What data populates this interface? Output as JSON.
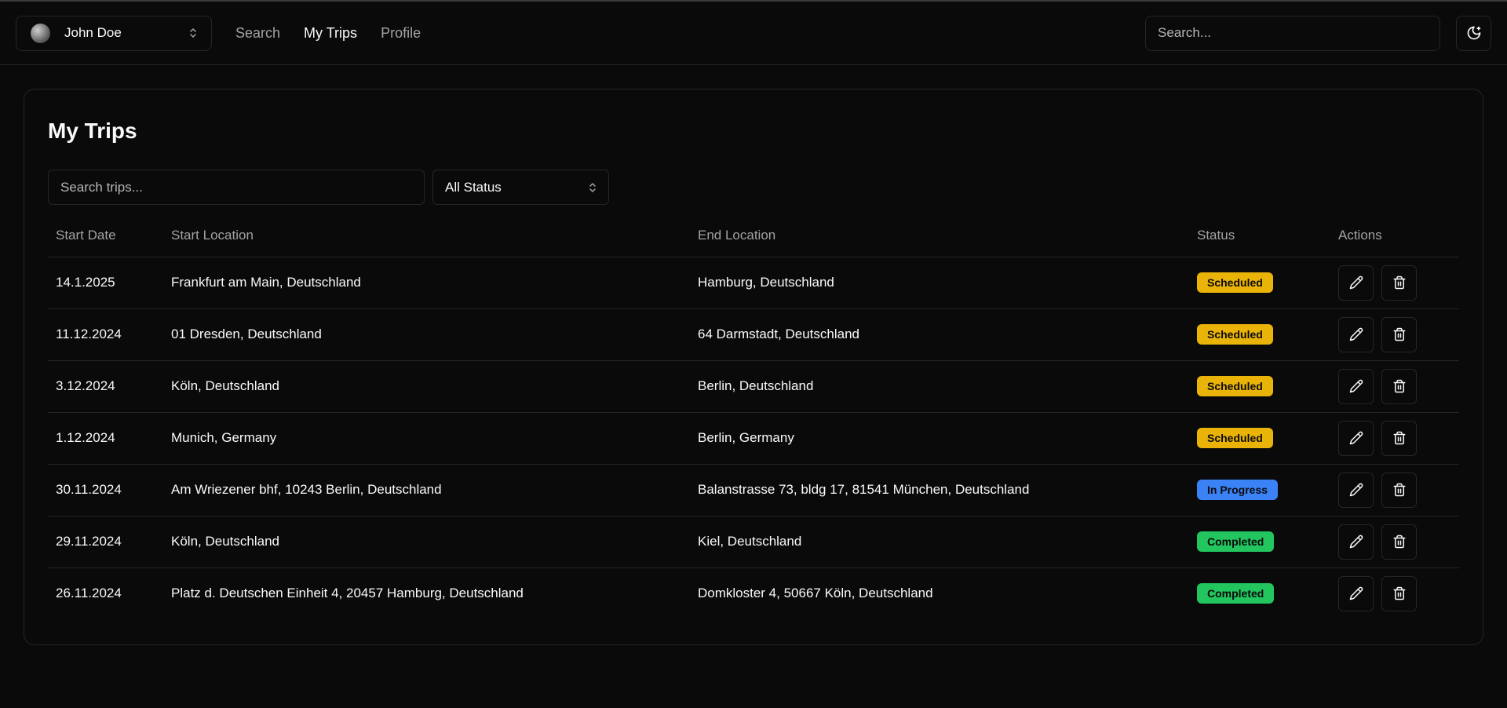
{
  "header": {
    "user_name": "John Doe",
    "nav": [
      {
        "label": "Search",
        "active": false
      },
      {
        "label": "My Trips",
        "active": true
      },
      {
        "label": "Profile",
        "active": false
      }
    ],
    "search_placeholder": "Search...",
    "theme_icon": "moon-icon"
  },
  "page": {
    "title": "My Trips",
    "search_placeholder": "Search trips...",
    "status_filter": "All Status"
  },
  "table": {
    "columns": [
      "Start Date",
      "Start Location",
      "End Location",
      "Status",
      "Actions"
    ],
    "rows": [
      {
        "date": "14.1.2025",
        "start": "Frankfurt am Main, Deutschland",
        "end": "Hamburg, Deutschland",
        "status": "Scheduled"
      },
      {
        "date": "11.12.2024",
        "start": "01 Dresden, Deutschland",
        "end": "64 Darmstadt, Deutschland",
        "status": "Scheduled"
      },
      {
        "date": "3.12.2024",
        "start": "Köln, Deutschland",
        "end": "Berlin, Deutschland",
        "status": "Scheduled"
      },
      {
        "date": "1.12.2024",
        "start": "Munich, Germany",
        "end": "Berlin, Germany",
        "status": "Scheduled"
      },
      {
        "date": "30.11.2024",
        "start": "Am Wriezener bhf, 10243 Berlin, Deutschland",
        "end": "Balanstrasse 73, bldg 17, 81541 München, Deutschland",
        "status": "In Progress"
      },
      {
        "date": "29.11.2024",
        "start": "Köln, Deutschland",
        "end": "Kiel, Deutschland",
        "status": "Completed"
      },
      {
        "date": "26.11.2024",
        "start": "Platz d. Deutschen Einheit 4, 20457 Hamburg, Deutschland",
        "end": "Domkloster 4, 50667 Köln, Deutschland",
        "status": "Completed"
      }
    ]
  },
  "status_colors": {
    "Scheduled": "#eab308",
    "In Progress": "#3b82f6",
    "Completed": "#22c55e"
  },
  "icons": {
    "edit": "pencil-icon",
    "delete": "trash-icon"
  }
}
